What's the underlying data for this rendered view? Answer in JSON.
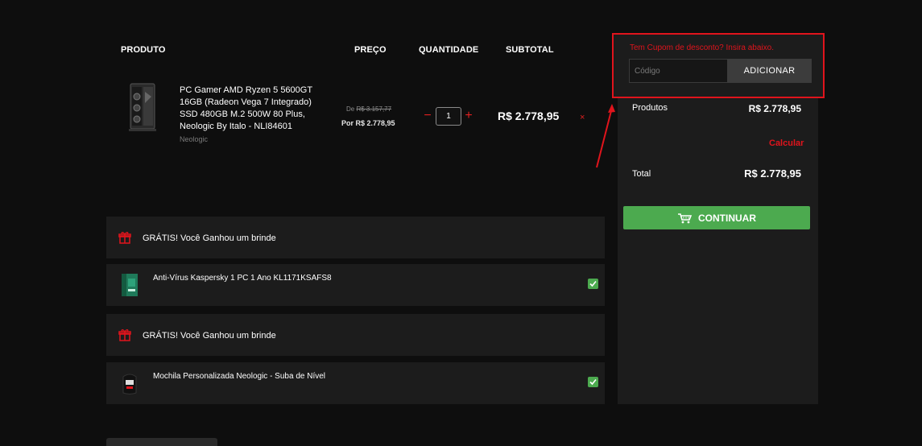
{
  "table_headers": {
    "product": "PRODUTO",
    "price": "PREÇO",
    "quantity": "QUANTIDADE",
    "subtotal": "SUBTOTAL"
  },
  "product": {
    "name": "PC Gamer AMD Ryzen 5 5600GT 16GB (Radeon Vega 7 Integrado) SSD 480GB M.2 500W 80 Plus, Neologic By Italo - NLI84601",
    "brand": "Neologic",
    "price_old_prefix": "De",
    "price_old": "R$ 3.157,77",
    "price_now": "Por R$ 2.778,95",
    "quantity": "1",
    "qty_minus": "−",
    "qty_plus": "+",
    "subtotal": "R$ 2.778,95",
    "remove": "×"
  },
  "coupon": {
    "prompt": "Tem Cupom de desconto? Insira abaixo.",
    "placeholder": "Código",
    "button": "ADICIONAR"
  },
  "summary": {
    "products_label": "Produtos",
    "products_value": "R$ 2.778,95",
    "calculate_link": "Calcular",
    "total_label": "Total",
    "total_value": "R$ 2.778,95",
    "continue_button": "CONTINUAR"
  },
  "gifts": [
    {
      "header": "GRÁTIS! Você Ganhou um brinde",
      "item": "Anti-Vírus Kaspersky 1 PC 1 Ano KL1171KSAFS8"
    },
    {
      "header": "GRÁTIS! Você Ganhou um brinde",
      "item": "Mochila Personalizada Neologic - Suba de Nível"
    }
  ],
  "colors": {
    "accent_red": "#e0141c",
    "accent_green": "#4caa4f",
    "panel": "#1c1c1c",
    "background": "#0e0e0e"
  },
  "icons": {
    "cart": "cart-icon",
    "gift": "gift-icon",
    "check": "check-icon",
    "remove": "close-icon"
  }
}
